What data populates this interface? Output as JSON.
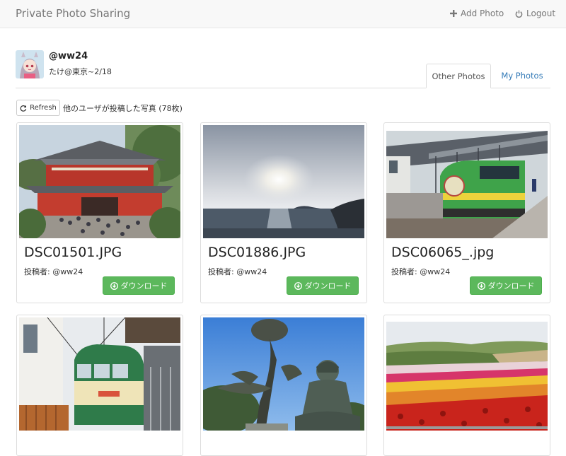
{
  "navbar": {
    "brand": "Private Photo Sharing",
    "add_photo": "Add Photo",
    "logout": "Logout"
  },
  "profile": {
    "handle": "@ww24",
    "bio": "たけ@東京~2/18"
  },
  "tabs": {
    "other": "Other Photos",
    "mine": "My Photos",
    "active": "other"
  },
  "toolbar": {
    "refresh": "Refresh",
    "count_text": "他のユーザが投稿した写真 (78枚)"
  },
  "photos": [
    {
      "title": "DSC01501.JPG",
      "owner": "投稿者: @ww24",
      "download": "ダウンロード",
      "scene": "temple"
    },
    {
      "title": "DSC01886.JPG",
      "owner": "投稿者: @ww24",
      "download": "ダウンロード",
      "scene": "sunset-sea"
    },
    {
      "title": "DSC06065_.jpg",
      "owner": "投稿者: @ww24",
      "download": "ダウンロード",
      "scene": "green-train"
    },
    {
      "title": "",
      "owner": "",
      "download": "",
      "scene": "tram"
    },
    {
      "title": "",
      "owner": "",
      "download": "",
      "scene": "great-buddha"
    },
    {
      "title": "",
      "owner": "",
      "download": "",
      "scene": "flower-field"
    }
  ],
  "colors": {
    "accent_link": "#337ab7",
    "download_green": "#5cb85c"
  }
}
